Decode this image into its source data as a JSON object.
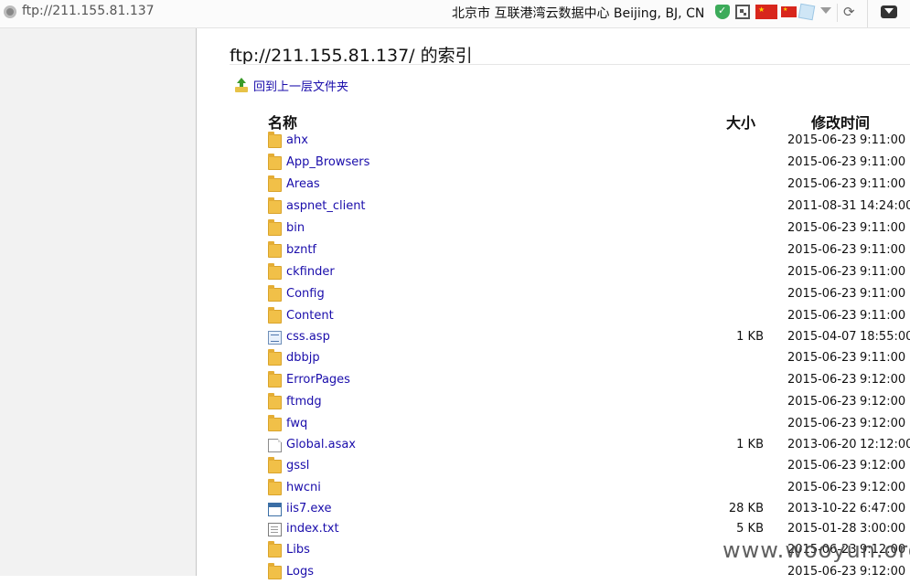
{
  "browser": {
    "address": "ftp://211.155.81.137",
    "location_info": "北京市 互联港湾云数据中心   Beijing, BJ, CN",
    "icons": [
      "globe-icon",
      "shield-icon",
      "qr-code-icon",
      "china-flag-icon",
      "china-flag-small-icon",
      "cube-icon",
      "dropdown-icon",
      "reload-icon",
      "menu-icon"
    ]
  },
  "page": {
    "title": "ftp://211.155.81.137/ 的索引",
    "up_link": "回到上一层文件夹"
  },
  "table": {
    "headers": {
      "name": "名称",
      "size": "大小",
      "modified": "修改时间"
    },
    "rows": [
      {
        "icon": "folder",
        "name": "ahx",
        "size": "",
        "date": "2015-06-23",
        "time": "9:11:00"
      },
      {
        "icon": "folder",
        "name": "App_Browsers",
        "size": "",
        "date": "2015-06-23",
        "time": "9:11:00"
      },
      {
        "icon": "folder",
        "name": "Areas",
        "size": "",
        "date": "2015-06-23",
        "time": "9:11:00"
      },
      {
        "icon": "folder",
        "name": "aspnet_client",
        "size": "",
        "date": "2011-08-31",
        "time": "14:24:00"
      },
      {
        "icon": "folder",
        "name": "bin",
        "size": "",
        "date": "2015-06-23",
        "time": "9:11:00"
      },
      {
        "icon": "folder",
        "name": "bzntf",
        "size": "",
        "date": "2015-06-23",
        "time": "9:11:00"
      },
      {
        "icon": "folder",
        "name": "ckfinder",
        "size": "",
        "date": "2015-06-23",
        "time": "9:11:00"
      },
      {
        "icon": "folder",
        "name": "Config",
        "size": "",
        "date": "2015-06-23",
        "time": "9:11:00"
      },
      {
        "icon": "folder",
        "name": "Content",
        "size": "",
        "date": "2015-06-23",
        "time": "9:11:00"
      },
      {
        "icon": "asp",
        "name": "css.asp",
        "size": "1 KB",
        "date": "2015-04-07",
        "time": "18:55:00"
      },
      {
        "icon": "folder",
        "name": "dbbjp",
        "size": "",
        "date": "2015-06-23",
        "time": "9:11:00"
      },
      {
        "icon": "folder",
        "name": "ErrorPages",
        "size": "",
        "date": "2015-06-23",
        "time": "9:12:00"
      },
      {
        "icon": "folder",
        "name": "ftmdg",
        "size": "",
        "date": "2015-06-23",
        "time": "9:12:00"
      },
      {
        "icon": "folder",
        "name": "fwq",
        "size": "",
        "date": "2015-06-23",
        "time": "9:12:00"
      },
      {
        "icon": "file",
        "name": "Global.asax",
        "size": "1 KB",
        "date": "2013-06-20",
        "time": "12:12:00"
      },
      {
        "icon": "folder",
        "name": "gssl",
        "size": "",
        "date": "2015-06-23",
        "time": "9:12:00"
      },
      {
        "icon": "folder",
        "name": "hwcni",
        "size": "",
        "date": "2015-06-23",
        "time": "9:12:00"
      },
      {
        "icon": "exe",
        "name": "iis7.exe",
        "size": "28 KB",
        "date": "2013-10-22",
        "time": "6:47:00"
      },
      {
        "icon": "txt",
        "name": "index.txt",
        "size": "5 KB",
        "date": "2015-01-28",
        "time": "3:00:00"
      },
      {
        "icon": "folder",
        "name": "Libs",
        "size": "",
        "date": "2015-06-23",
        "time": "9:12:00"
      },
      {
        "icon": "folder",
        "name": "Logs",
        "size": "",
        "date": "2015-06-23",
        "time": "9:12:00"
      }
    ]
  },
  "watermark": "www.wooyun.org"
}
